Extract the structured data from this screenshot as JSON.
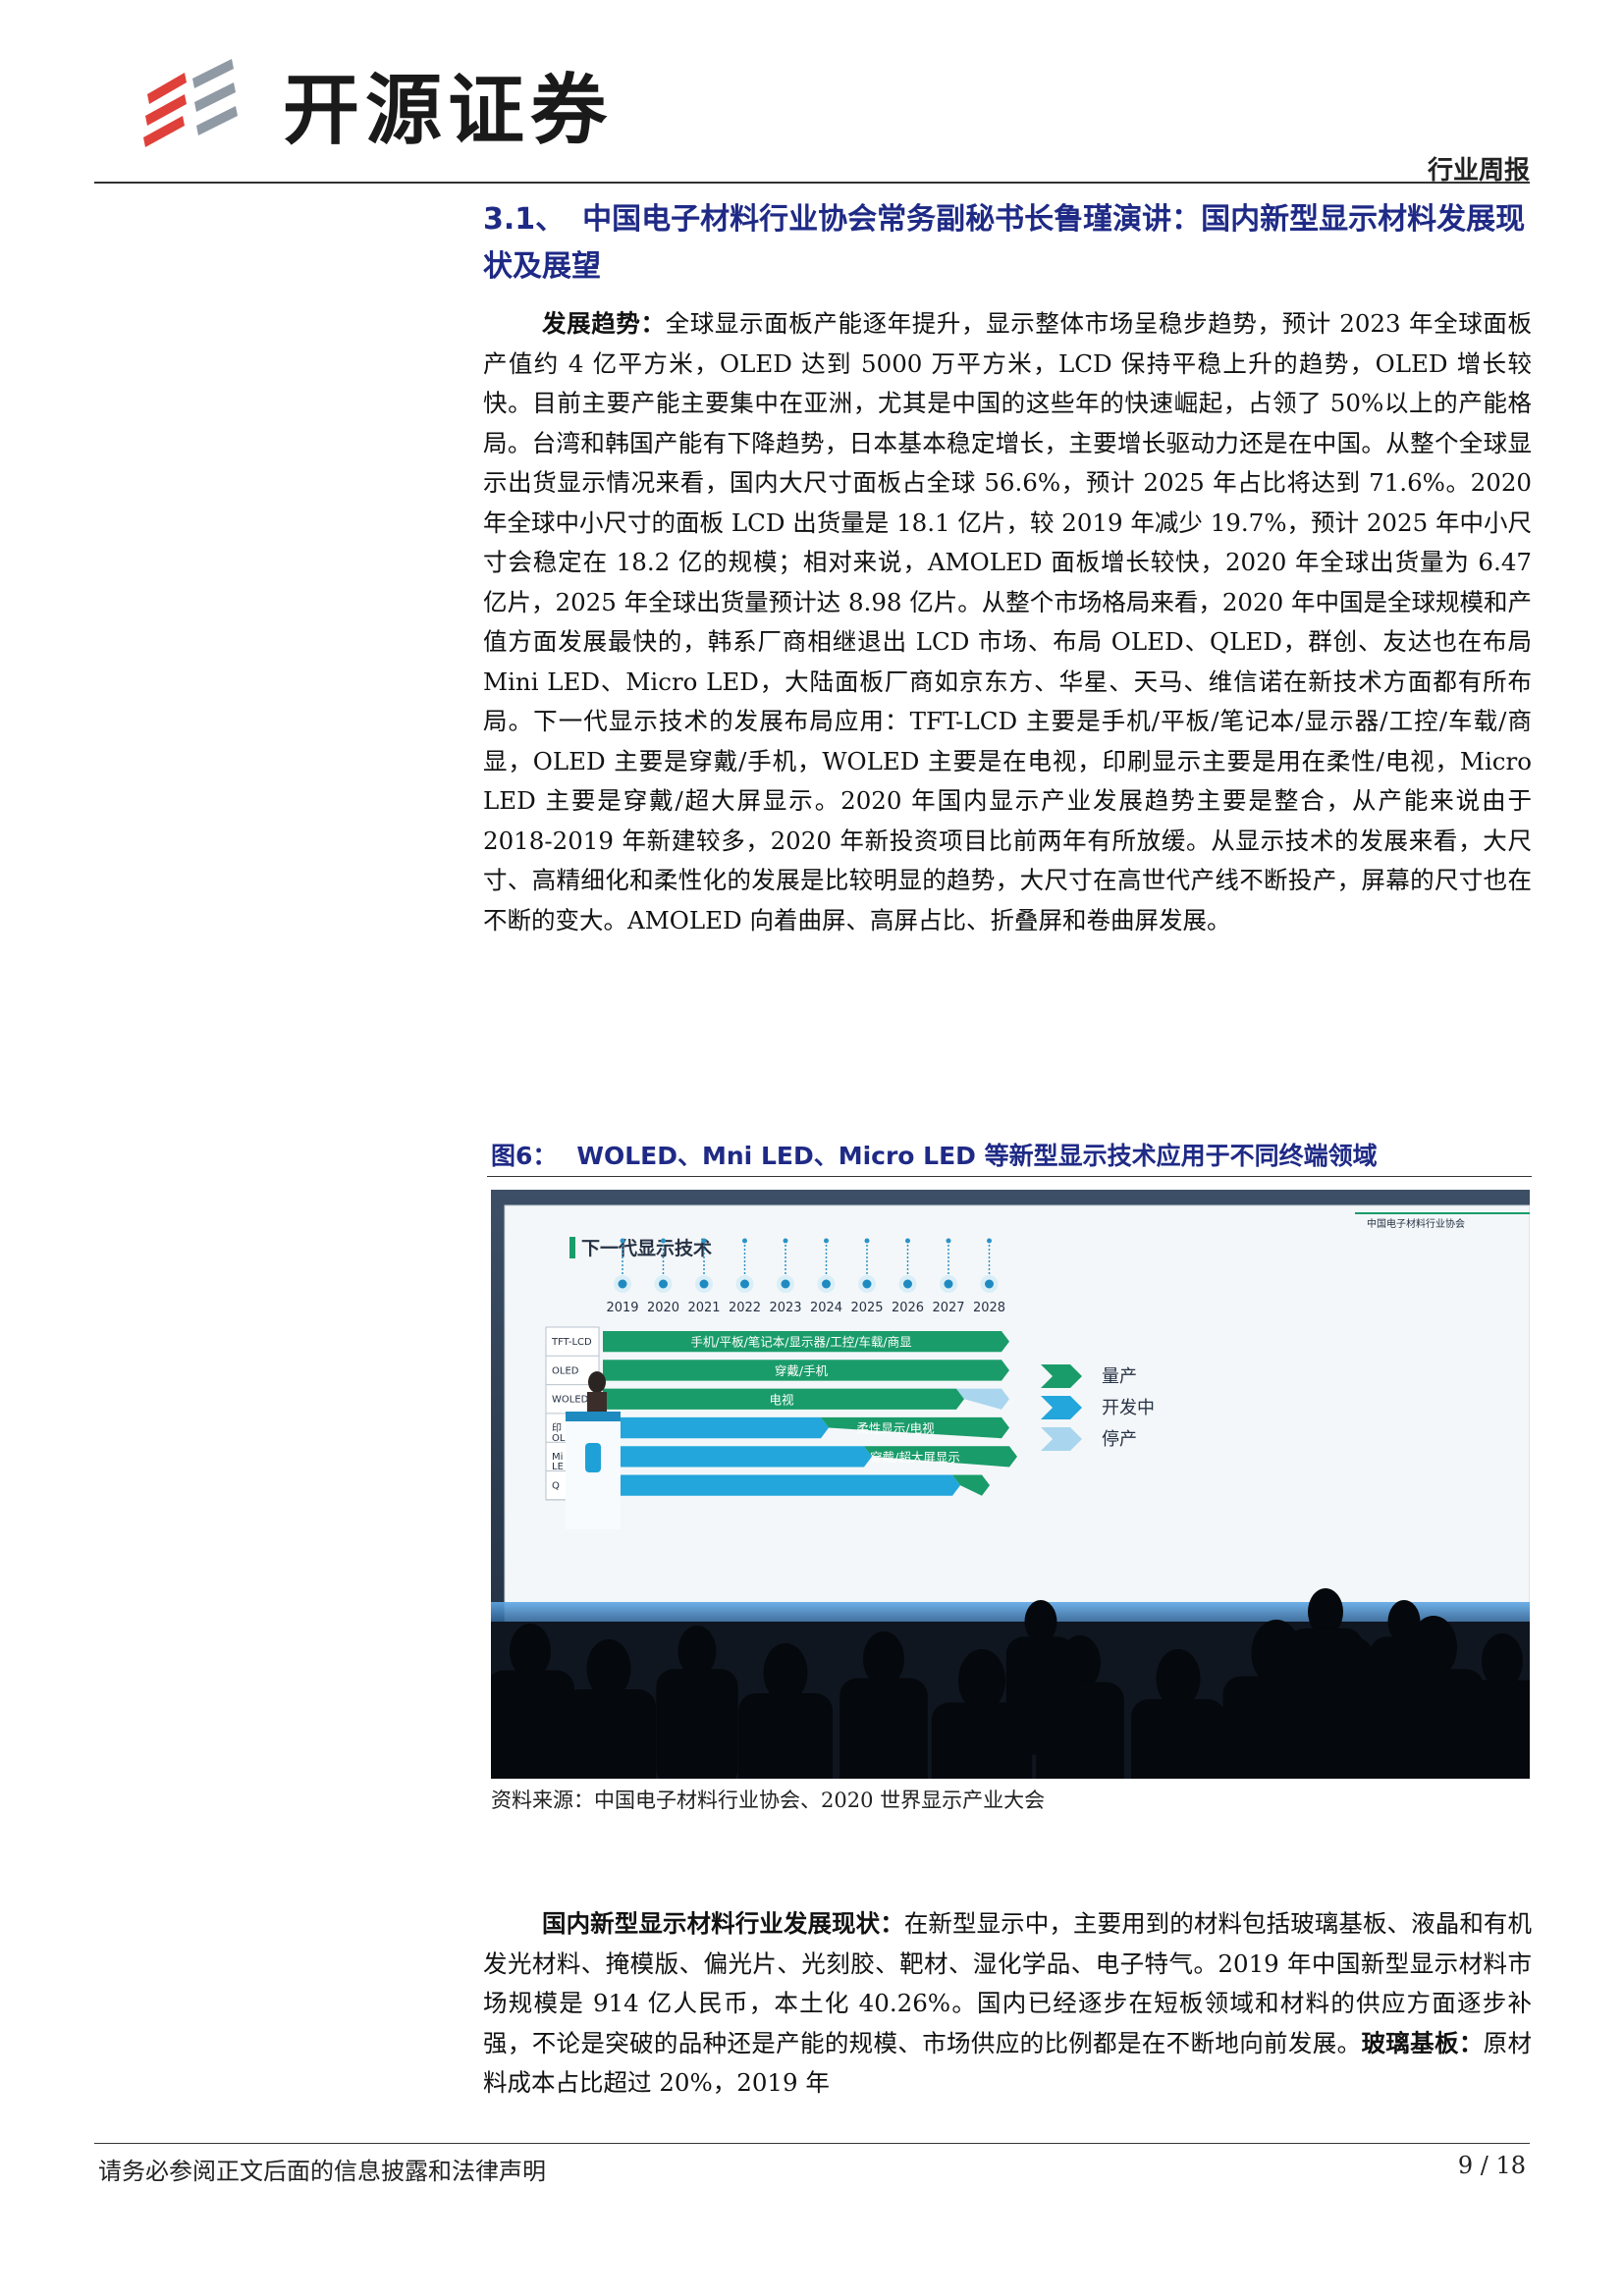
{
  "header": {
    "brand": "开源证券",
    "report_type": "行业周报"
  },
  "section": {
    "number": "3.1、",
    "title": "中国电子材料行业协会常务副秘书长鲁瑾演讲：国内新型显示材料发展现状及展望"
  },
  "para1": {
    "lead": "发展趋势：",
    "text": "全球显示面板产能逐年提升，显示整体市场呈稳步趋势，预计 2023 年全球面板产值约 4 亿平方米，OLED 达到 5000 万平方米，LCD 保持平稳上升的趋势，OLED 增长较快。目前主要产能主要集中在亚洲，尤其是中国的这些年的快速崛起，占领了 50%以上的产能格局。台湾和韩国产能有下降趋势，日本基本稳定增长，主要增长驱动力还是在中国。从整个全球显示出货显示情况来看，国内大尺寸面板占全球 56.6%，预计 2025 年占比将达到 71.6%。2020 年全球中小尺寸的面板 LCD 出货量是 18.1 亿片，较 2019 年减少 19.7%，预计 2025 年中小尺寸会稳定在 18.2 亿的规模；相对来说，AMOLED 面板增长较快，2020 年全球出货量为 6.47 亿片，2025 年全球出货量预计达 8.98 亿片。从整个市场格局来看，2020 年中国是全球规模和产值方面发展最快的，韩系厂商相继退出 LCD 市场、布局 OLED、QLED，群创、友达也在布局 Mini LED、Micro LED，大陆面板厂商如京东方、华星、天马、维信诺在新技术方面都有所布局。下一代显示技术的发展布局应用：TFT-LCD 主要是手机/平板/笔记本/显示器/工控/车载/商显，OLED 主要是穿戴/手机，WOLED 主要是在电视，印刷显示主要是用在柔性/电视，Micro LED 主要是穿戴/超大屏显示。2020 年国内显示产业发展趋势主要是整合，从产能来说由于 2018-2019 年新建较多，2020 年新投资项目比前两年有所放缓。从显示技术的发展来看，大尺寸、高精细化和柔性化的发展是比较明显的趋势，大尺寸在高世代产线不断投产，屏幕的尺寸也在不断的变大。AMOLED 向着曲屏、高屏占比、折叠屏和卷曲屏发展。"
  },
  "figure": {
    "number": "图6：",
    "title": "WOLED、Mni LED、Micro LED 等新型显示技术应用于不同终端领域",
    "source": "资料来源：中国电子材料行业协会、2020 世界显示产业大会",
    "slide": {
      "title": "下一代显示技术",
      "org": "中国电子材料行业协会",
      "years": [
        "2019",
        "2020",
        "2021",
        "2022",
        "2023",
        "2024",
        "2025",
        "2026",
        "2027",
        "2028"
      ],
      "rows": [
        {
          "label": "TFT-LCD",
          "text": "手机/平板/笔记本/显示器/工控/车载/商显"
        },
        {
          "label": "OLED",
          "text": "穿戴/手机"
        },
        {
          "label": "WOLED",
          "text": "电视"
        },
        {
          "label": "印",
          "label2": "OL",
          "text": "柔性显示/电视"
        },
        {
          "label": "Mi",
          "label2": "LE",
          "text": "穿戴/超大屏显示"
        },
        {
          "label": "Q",
          "text": ""
        }
      ],
      "legend": [
        "量产",
        "开发中",
        "停产"
      ],
      "colors": {
        "mass": "#1a9c6a",
        "dev": "#22a6dc",
        "stop": "#a9d6ee"
      }
    }
  },
  "para2": {
    "lead": "国内新型显示材料行业发展现状：",
    "text1": "在新型显示中，主要用到的材料包括玻璃基板、液晶和有机发光材料、掩模版、偏光片、光刻胶、靶材、湿化学品、电子特气。2019 年中国新型显示材料市场规模是 914 亿人民币，本土化 40.26%。国内已经逐步在短板领域和材料的供应方面逐步补强，不论是突破的品种还是产能的规模、市场供应的比例都是在不断地向前发展。",
    "lead2": "玻璃基板：",
    "text2": "原材料成本占比超过 20%，2019 年"
  },
  "footer": {
    "disclaimer": "请务必参阅正文后面的信息披露和法律声明",
    "page": "9 / 18"
  }
}
